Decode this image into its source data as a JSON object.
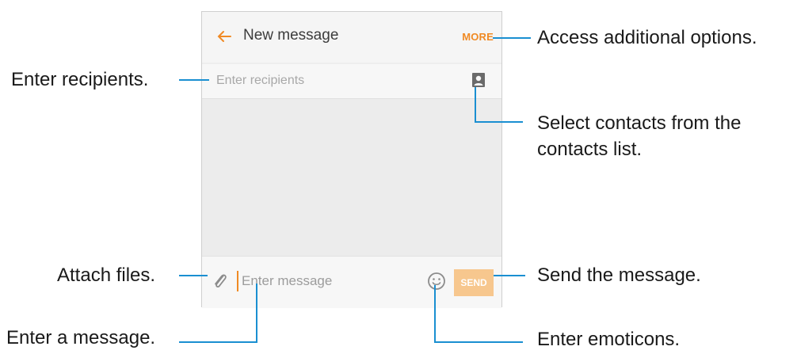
{
  "app": {
    "title": "New message",
    "more_label": "MORE",
    "back_icon": "arrow-left-icon",
    "accent_color": "#f08a24"
  },
  "recipients": {
    "placeholder": "Enter recipients",
    "contact_icon": "contact-card-icon"
  },
  "compose": {
    "placeholder": "Enter message",
    "attach_icon": "paperclip-icon",
    "emoji_icon": "smiley-icon",
    "send_label": "SEND"
  },
  "callouts": {
    "more": "Access additional options.",
    "recipients": "Enter recipients.",
    "contacts_line1": "Select contacts from the",
    "contacts_line2": "contacts list.",
    "attach": "Attach files.",
    "send": "Send the message.",
    "message": "Enter a message.",
    "emoticons": "Enter emoticons."
  },
  "colors": {
    "callout_line": "#1a8fd1"
  }
}
